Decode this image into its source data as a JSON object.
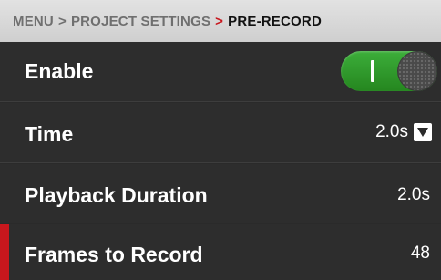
{
  "breadcrumb": {
    "items": [
      "MENU",
      "PROJECT SETTINGS"
    ],
    "separator": ">",
    "current": "PRE-RECORD"
  },
  "rows": {
    "enable": {
      "label": "Enable",
      "state": "on"
    },
    "time": {
      "label": "Time",
      "value": "2.0s"
    },
    "playback_duration": {
      "label": "Playback Duration",
      "value": "2.0s"
    },
    "frames_to_record": {
      "label": "Frames to Record",
      "value": "48"
    }
  },
  "colors": {
    "accent_red": "#c8171d",
    "toggle_green": "#2f9a2b",
    "row_background": "#2d2d2d",
    "header_background": "#d8d8d8"
  },
  "icons": {
    "time_dropdown": "chevron-down-icon",
    "toggle_knob": "toggle-knob-icon"
  }
}
